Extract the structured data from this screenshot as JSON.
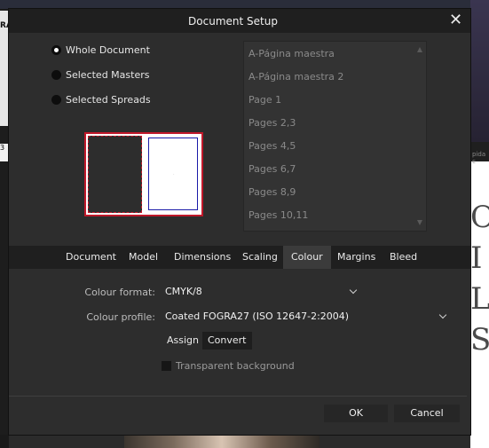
{
  "background": {
    "left_text": "RA",
    "left_tab": "3",
    "right_small": "pida c",
    "right_letters": [
      "O",
      "I",
      "L",
      "S"
    ]
  },
  "dialog": {
    "title": "Document Setup",
    "close_glyph": "✕"
  },
  "scope": {
    "options": [
      {
        "label": "Whole Document",
        "selected": true
      },
      {
        "label": "Selected Masters",
        "selected": false
      },
      {
        "label": "Selected Spreads",
        "selected": false
      }
    ]
  },
  "pages": {
    "items": [
      "A-Página maestra",
      "A-Página maestra 2",
      "Page 1",
      "Pages 2,3",
      "Pages 4,5",
      "Pages 6,7",
      "Pages 8,9",
      "Pages 10,11"
    ]
  },
  "tabs": {
    "items": [
      "Document",
      "Model",
      "Dimensions",
      "Scaling",
      "Colour",
      "Margins",
      "Bleed"
    ],
    "active": "Colour"
  },
  "colour": {
    "format_label": "Colour format:",
    "format_value": "CMYK/8",
    "profile_label": "Colour profile:",
    "profile_value": "Coated FOGRA27 (ISO 12647-2:2004)",
    "assign_label": "Assign",
    "convert_label": "Convert",
    "transparent_label": "Transparent background",
    "transparent_checked": false
  },
  "footer": {
    "ok_label": "OK",
    "cancel_label": "Cancel"
  },
  "colors": {
    "dialog_bg": "#2d2d2d",
    "titlebar_bg": "#1f1f1f",
    "preview_border": "#c0182a",
    "page_outline": "#1a1aa8"
  }
}
